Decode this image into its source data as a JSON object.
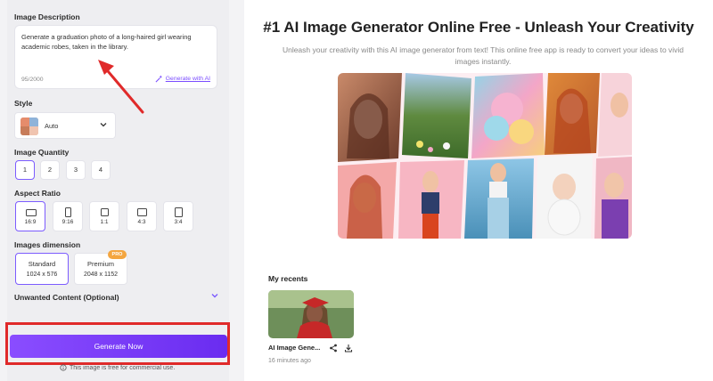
{
  "left": {
    "description_label": "Image Description",
    "description_text": "Generate a graduation photo of a long-haired girl wearing academic robes, taken in the library.",
    "char_counter": "95/2000",
    "generate_with_ai": "Generate with AI",
    "style_label": "Style",
    "style_value": "Auto",
    "quantity_label": "Image Quantity",
    "quantities": [
      "1",
      "2",
      "3",
      "4"
    ],
    "selected_quantity": "1",
    "aspect_label": "Aspect Ratio",
    "aspects": [
      "16:9",
      "9:16",
      "1:1",
      "4:3",
      "3:4"
    ],
    "selected_aspect": "16:9",
    "dimension_label": "Images dimension",
    "dimensions": [
      {
        "title": "Standard",
        "size": "1024 x 576"
      },
      {
        "title": "Premium",
        "size": "2048 x 1152"
      }
    ],
    "pro_badge": "PRO",
    "unwanted_label": "Unwanted Content (Optional)",
    "generate_button": "Generate Now",
    "free_note": "This image is free for commercial use."
  },
  "right": {
    "title": "#1 AI Image Generator Online Free - Unleash Your Creativity",
    "subtitle": "Unleash your creativity with this AI image generator from text! This online free app is ready to convert your ideas to vivid images instantly.",
    "recents_title": "My recents",
    "recent_item": {
      "name": "AI Image Gene...",
      "time": "16 minutes ago"
    }
  },
  "colors": {
    "accent": "#7c5cff",
    "button_gradient_start": "#8a4dff",
    "button_gradient_end": "#6a2cf0",
    "highlight_red": "#e02a2a",
    "pro_badge": "#f4a640"
  },
  "icons": [
    "magic-wand-icon",
    "chevron-down-icon",
    "share-icon",
    "download-icon",
    "info-circle-icon"
  ]
}
